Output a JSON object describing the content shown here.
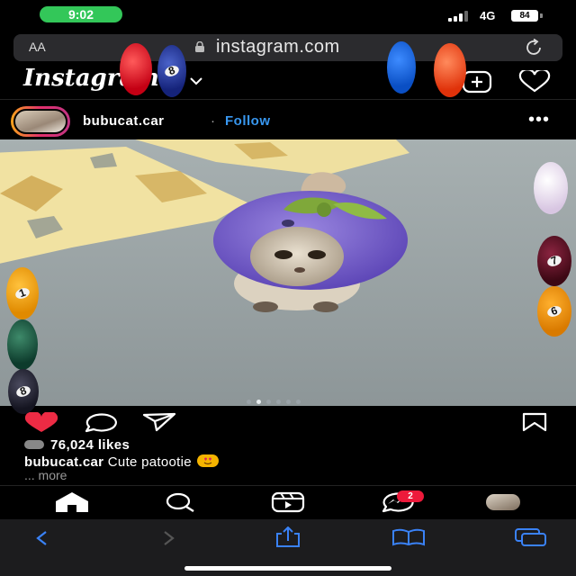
{
  "status_bar": {
    "time": "9:02",
    "network": "4G",
    "battery": "84"
  },
  "browser": {
    "text_size_label": "AA",
    "url": "instagram.com"
  },
  "app": {
    "logo_text": "Instagram"
  },
  "post": {
    "username": "bubucat.car",
    "separator": "·",
    "follow_label": "Follow",
    "more_options": "•••",
    "likes": "76,024 likes",
    "caption_user": "bubucat.car",
    "caption_text": "Cute patootie",
    "more_label": "... more",
    "carousel": {
      "total": 6,
      "active_index": 1
    }
  },
  "bottom_nav": {
    "messages_badge": "2",
    "items": [
      "home-icon",
      "search-icon",
      "reels-icon",
      "messages-icon",
      "profile-avatar"
    ]
  },
  "colors": {
    "follow": "#3897f0",
    "like": "#ed2b44",
    "badge": "#ed1a3b",
    "time_pill": "#33c759"
  },
  "balls": {
    "top_left_blue_number": "8",
    "right_maroon_number": "7",
    "right_orange_number": "6",
    "left_orange_number": "1",
    "left_dark_number": "8"
  }
}
